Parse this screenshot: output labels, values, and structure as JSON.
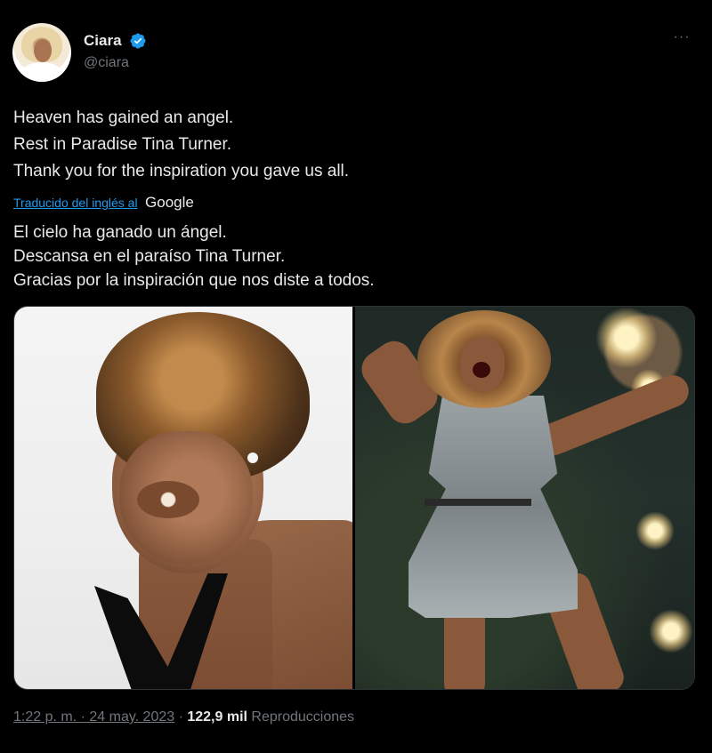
{
  "author": {
    "display_name": "Ciara",
    "handle": "@ciara",
    "verified_icon": "verified-badge-icon",
    "avatar": "avatar"
  },
  "menu": {
    "more_icon": "more-options-icon",
    "more_glyph": "···"
  },
  "tweet": {
    "lines": [
      "Heaven has gained an angel.",
      "Rest in Paradise Tina Turner.",
      "Thank you for the inspiration you gave us all."
    ],
    "translation": {
      "link_label": "Traducido del inglés al",
      "provider": "Google"
    },
    "translated_lines": [
      "El cielo ha ganado un ángel.",
      "Descansa en el paraíso Tina Turner.",
      "Gracias por la inspiración que nos diste a todos."
    ]
  },
  "media": {
    "photos": [
      "photo-1",
      "photo-2"
    ]
  },
  "footer": {
    "time": "1:22 p. m.",
    "separator1": " · ",
    "date": "24 may. 2023",
    "separator2": " · ",
    "views_count": "122,9 mil",
    "views_label": "Reproducciones"
  },
  "colors": {
    "background": "#000000",
    "text": "#e7e9ea",
    "secondary": "#71767b",
    "link": "#1d9bf0",
    "verified": "#1d9bf0"
  }
}
